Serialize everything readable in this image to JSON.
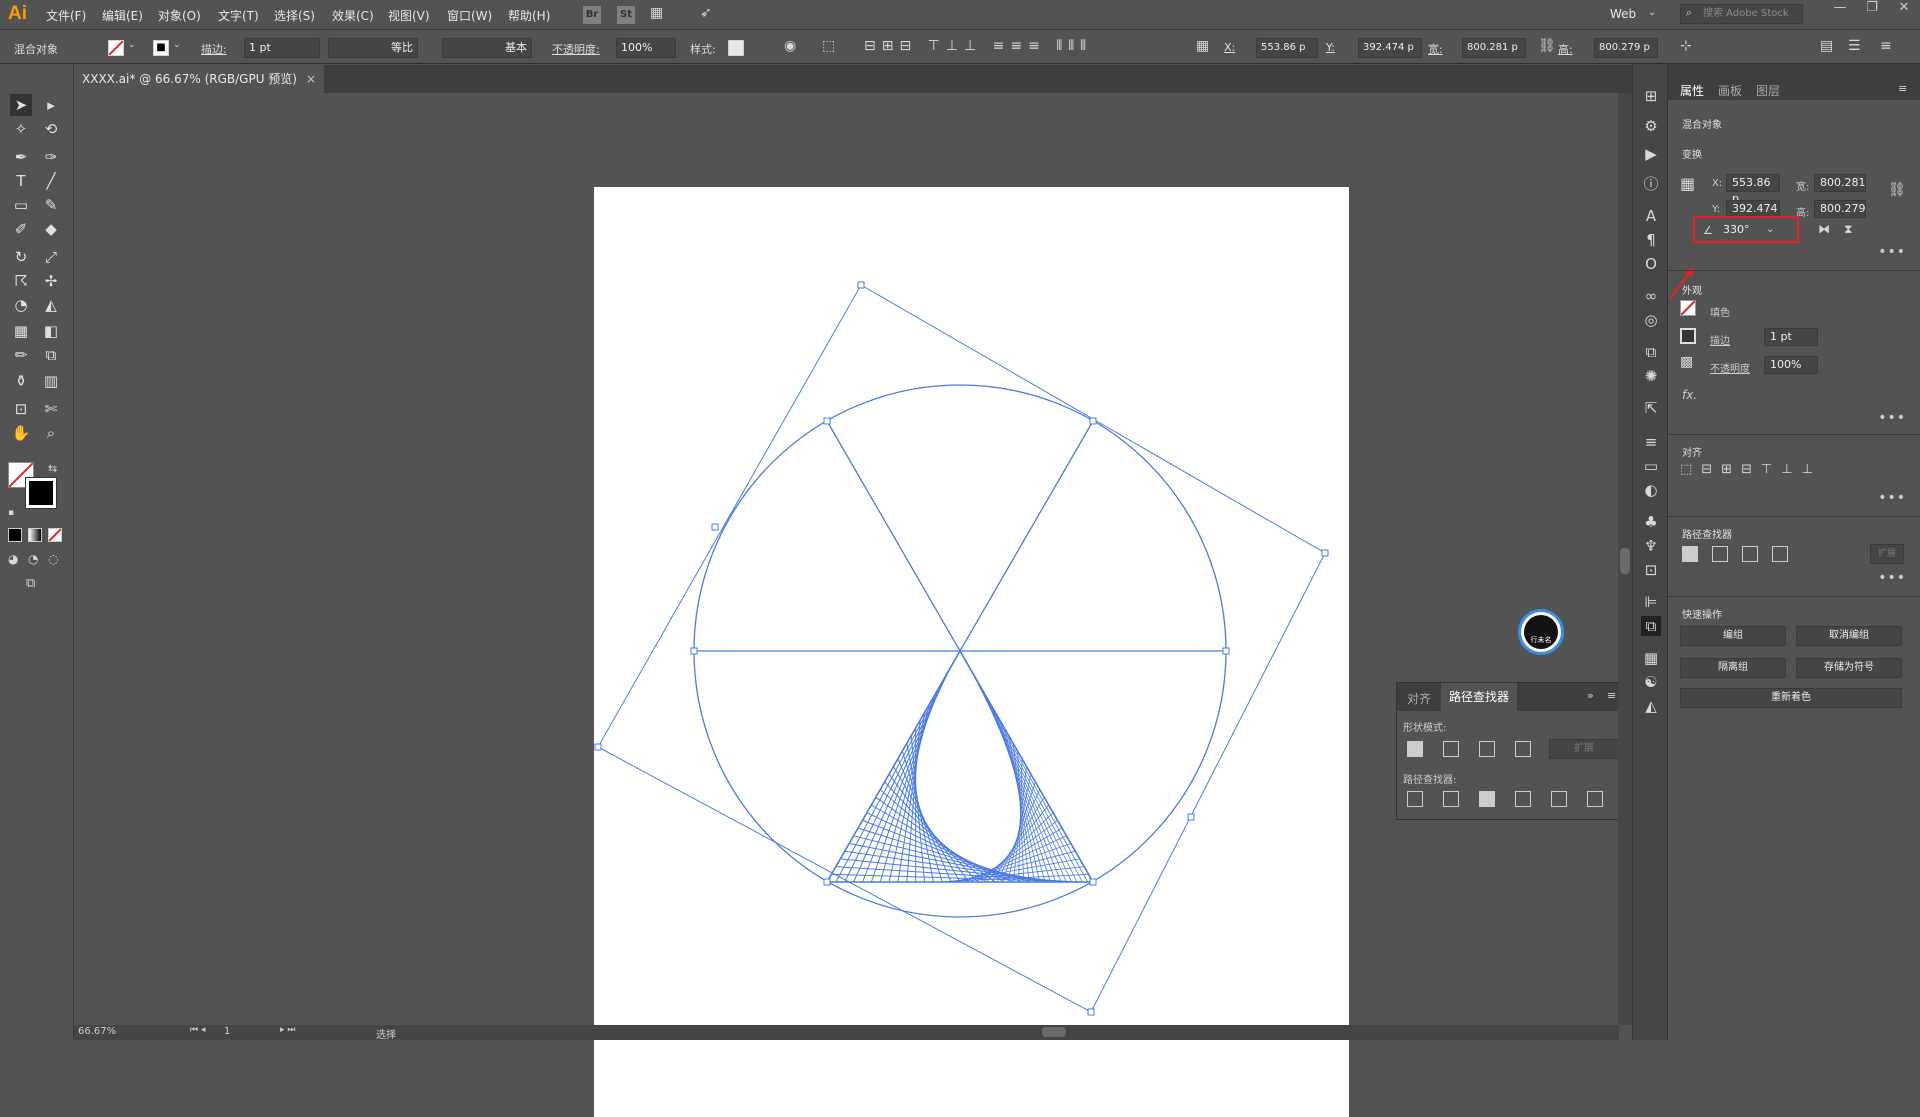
{
  "app": {
    "logo": "Ai",
    "workspace": "Web",
    "search_placeholder": "搜索 Adobe Stock"
  },
  "menu": [
    "文件(F)",
    "编辑(E)",
    "对象(O)",
    "文字(T)",
    "选择(S)",
    "效果(C)",
    "视图(V)",
    "窗口(W)",
    "帮助(H)"
  ],
  "menubar_buttons": [
    "Br",
    "St"
  ],
  "control": {
    "object_type": "混合对象",
    "stroke_label": "描边:",
    "stroke_value": "1 pt",
    "profile_label": "等比",
    "brush_label": "基本",
    "opacity_label": "不透明度:",
    "opacity_value": "100%",
    "style_label": "样式:",
    "x_label": "X:",
    "x_value": "553.86 p",
    "y_label": "Y:",
    "y_value": "392.474 p",
    "w_label": "宽:",
    "w_value": "800.281 p",
    "h_label": "高:",
    "h_value": "800.279 p"
  },
  "document": {
    "tab_title": "XXXX.ai* @ 66.67% (RGB/GPU 预览)",
    "close": "×"
  },
  "status": {
    "zoom": "66.67%",
    "artboard_num": "1",
    "tool": "选择"
  },
  "properties": {
    "tabs": [
      "属性",
      "画板",
      "图层"
    ],
    "object_type": "混合对象",
    "transform": {
      "title": "变换",
      "x_label": "X:",
      "x": "553.86 p",
      "y_label": "Y:",
      "y": "392.474",
      "w_label": "宽:",
      "w": "800.281",
      "h_label": "高:",
      "h": "800.279",
      "angle": "330°"
    },
    "appearance": {
      "title": "外观",
      "fill": "填色",
      "stroke": "描边",
      "stroke_value": "1 pt",
      "opacity": "不透明度",
      "opacity_value": "100%",
      "fx": "fx."
    },
    "align_title": "对齐",
    "pathfinder_title": "路径查找器",
    "pathfinder_expand": "扩展",
    "quick_actions": {
      "title": "快速操作",
      "edit_group": "编组",
      "ungroup": "取消编组",
      "isolate": "隔离组",
      "save_symbol": "存储为符号",
      "recolor": "重新着色"
    }
  },
  "floating_panel": {
    "tabs": [
      "对齐",
      "路径查找器"
    ],
    "shape_modes": "形状模式:",
    "pathfinders": "路径查找器:",
    "expand": "扩展"
  },
  "watermark": {
    "text": "行未名"
  },
  "colors": {
    "accent": "#4a7be8",
    "highlight": "#e8202a",
    "ui_bg": "#535353"
  }
}
